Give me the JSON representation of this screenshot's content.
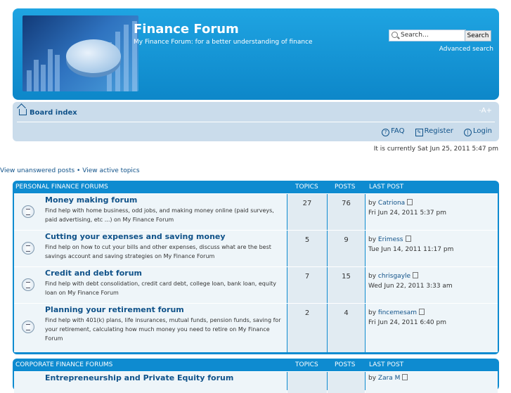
{
  "header": {
    "site_title": "Finance Forum",
    "site_description": "My Finance Forum: for a better understanding of finance",
    "search_placeholder": "Search…",
    "search_button": "Search",
    "advanced_search": "Advanced search"
  },
  "navbar": {
    "board_index": "Board index",
    "font_change": "-A+",
    "faq": "FAQ",
    "register": "Register",
    "login": "Login"
  },
  "current_time": "It is currently Sat Jun 25, 2011 5:47 pm",
  "quick_links": {
    "unanswered": "View unanswered posts",
    "separator": "•",
    "active": "View active topics"
  },
  "categories": [
    {
      "name": "PERSONAL FINANCE FORUMS",
      "col_topics": "TOPICS",
      "col_posts": "POSTS",
      "col_last": "LAST POST",
      "forums": [
        {
          "title": "Money making forum",
          "description": "Find help with home business, odd jobs, and making money online (paid surveys, paid advertising, etc ...) on My Finance Forum",
          "topics": "27",
          "posts": "76",
          "last_by": "by",
          "last_user": "Catriona",
          "last_time": "Fri Jun 24, 2011 5:37 pm"
        },
        {
          "title": "Cutting your expenses and saving money",
          "description": "Find help on how to cut your bills and other expenses, discuss what are the best savings account and saving strategies on My Finance Forum",
          "topics": "5",
          "posts": "9",
          "last_by": "by",
          "last_user": "Erimess",
          "last_time": "Tue Jun 14, 2011 11:17 pm"
        },
        {
          "title": "Credit and debt forum",
          "description": "Find help with debt consolidation, credit card debt, college loan, bank loan, equity loan on My Finance Forum",
          "topics": "7",
          "posts": "15",
          "last_by": "by",
          "last_user": "chrisgayle",
          "last_time": "Wed Jun 22, 2011 3:33 am"
        },
        {
          "title": "Planning your retirement forum",
          "description": "Find help with 401(k) plans, life insurances, mutual funds, pension funds, saving for your retirement, calculating how much money you need to retire on My Finance Forum",
          "topics": "2",
          "posts": "4",
          "last_by": "by",
          "last_user": "fincemesam",
          "last_time": "Fri Jun 24, 2011 6:40 pm"
        }
      ]
    },
    {
      "name": "CORPORATE FINANCE FORUMS",
      "col_topics": "TOPICS",
      "col_posts": "POSTS",
      "col_last": "LAST POST",
      "forums": [
        {
          "title": "Entrepreneurship and Private Equity forum",
          "last_by": "by",
          "last_user": "Zara M"
        }
      ]
    }
  ]
}
